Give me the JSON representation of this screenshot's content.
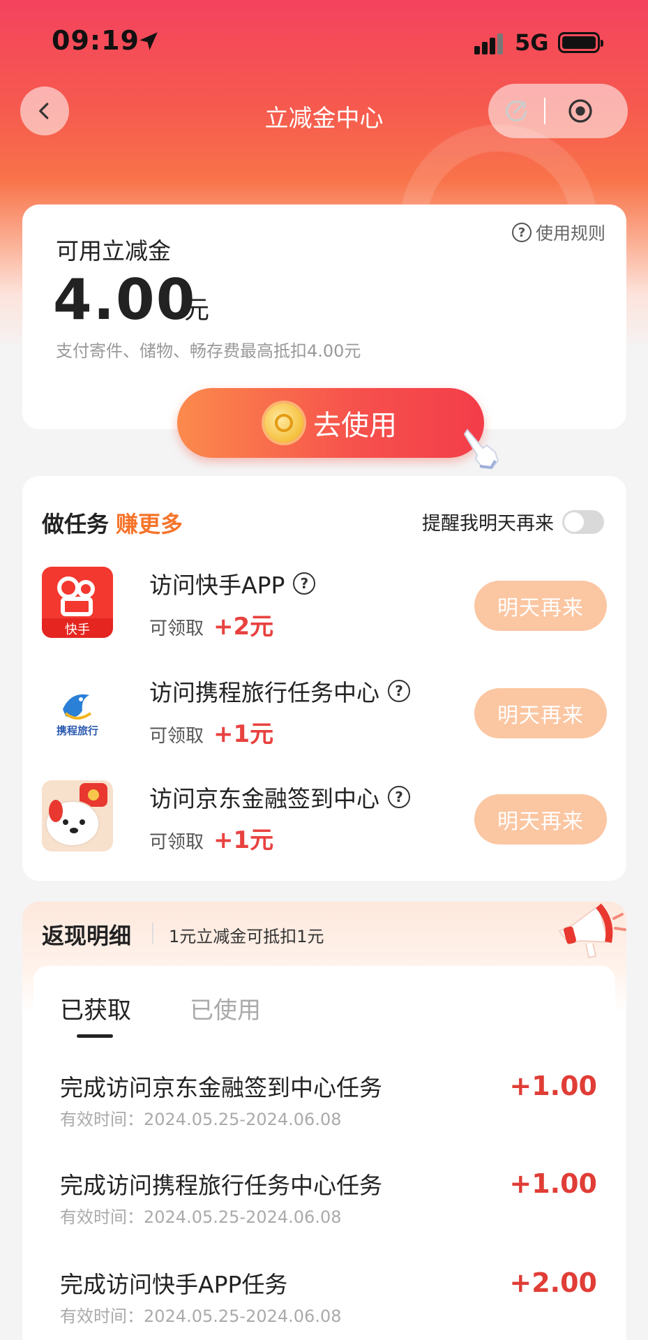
{
  "status_bar": {
    "time": "09:19",
    "network": "5G"
  },
  "header": {
    "title": "立减金中心"
  },
  "balance": {
    "label": "可用立减金",
    "amount": "4.00",
    "unit": "元",
    "description": "支付寄件、储物、畅存费最高抵扣4.00元",
    "rules_link": "使用规则",
    "use_button": "去使用"
  },
  "tasks": {
    "title": "做任务",
    "title_highlight": "赚更多",
    "reminder_label": "提醒我明天再来",
    "reminder_on": false,
    "items": [
      {
        "name": "访问快手APP",
        "reward_label": "可领取",
        "reward": "+2元",
        "button": "明天再来",
        "icon": "kuaishou-logo"
      },
      {
        "name": "访问携程旅行任务中心",
        "reward_label": "可领取",
        "reward": "+1元",
        "button": "明天再来",
        "icon": "ctrip-logo"
      },
      {
        "name": "访问京东金融签到中心",
        "reward_label": "可领取",
        "reward": "+1元",
        "button": "明天再来",
        "icon": "jd-finance-logo"
      }
    ]
  },
  "cashback": {
    "title": "返现明细",
    "note": "1元立减金可抵扣1元",
    "tabs": [
      {
        "label": "已获取",
        "active": true
      },
      {
        "label": "已使用",
        "active": false
      }
    ],
    "records": [
      {
        "name": "完成访问京东金融签到中心任务",
        "validity": "有效时间：2024.05.25-2024.06.08",
        "value": "+1.00"
      },
      {
        "name": "完成访问携程旅行任务中心任务",
        "validity": "有效时间：2024.05.25-2024.06.08",
        "value": "+1.00"
      },
      {
        "name": "完成访问快手APP任务",
        "validity": "有效时间：2024.05.25-2024.06.08",
        "value": "+2.00"
      }
    ]
  },
  "colors": {
    "accent": "#f5742a",
    "brand_red": "#f4435e",
    "value_red": "#e03d36",
    "button_peach": "#fbc6a2"
  }
}
